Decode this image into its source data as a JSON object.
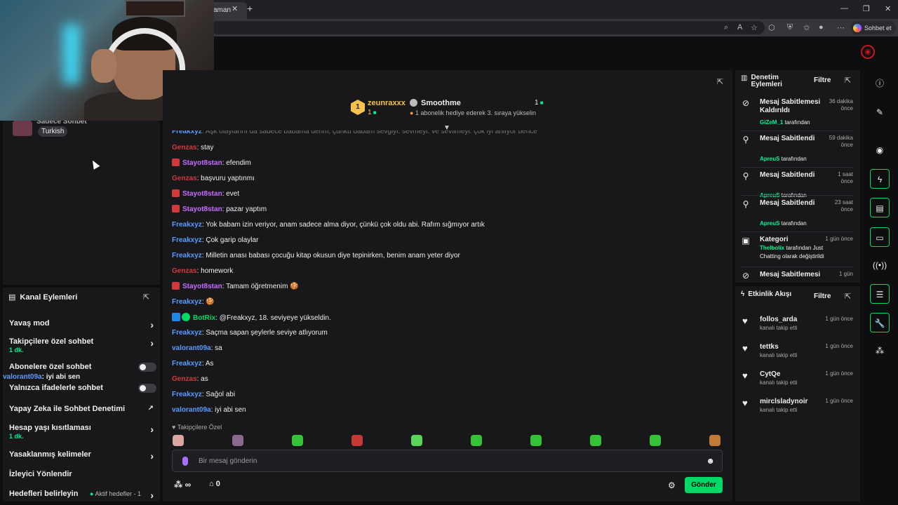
{
  "browser": {
    "tab_title": "aman",
    "copilot_label": "Sohbet et"
  },
  "stream_info": {
    "language_tag": "Turkish",
    "user_line": "Sadece Sohbet"
  },
  "hype_train": {
    "top_user": "zeunraxxx",
    "top_user_count": "1",
    "level_badge": "1",
    "second_user": "Smoothme",
    "second_count": "1",
    "sub_text": "1 abonelik hediye ederek 3. sıraya yükselin"
  },
  "channel_actions": {
    "title": "Kanal Eylemleri",
    "items": [
      {
        "label": "Yavaş mod",
        "sub": ""
      },
      {
        "label": "Takipçilere özel sohbet",
        "sub": "1 dk."
      },
      {
        "label": "Abonelere özel sohbet",
        "sub": ""
      },
      {
        "label": "Yalnızca ifadelerle sohbet",
        "sub": ""
      },
      {
        "label": "Yapay Zeka ile Sohbet Denetimi",
        "sub": ""
      },
      {
        "label": "Hesap yaşı kısıtlaması",
        "sub": "1 dk."
      },
      {
        "label": "Yasaklanmış kelimeler",
        "sub": ""
      },
      {
        "label": "İzleyici Yönlendir",
        "sub": ""
      },
      {
        "label": "Hedefleri belirleyin",
        "sub": ""
      }
    ],
    "goals_tag": "Aktif hedefler - 1",
    "overlay_user": "valorant09a",
    "overlay_text": ": iyi abi sen"
  },
  "chat": {
    "messages": [
      {
        "user": "Freakxyz",
        "color": "blue",
        "badge": "",
        "text": ": Aşk olaylarını da sadece babama derim, çünkü babam sevgiyi. sevmeyi. ve sevilmeyi. çok iyi anlıyor bence"
      },
      {
        "user": "Genzas",
        "color": "red",
        "badge": "",
        "text": ": stay"
      },
      {
        "user": "Stayot8stan",
        "color": "purple",
        "badge": "red",
        "text": ": efendim"
      },
      {
        "user": "Genzas",
        "color": "red",
        "badge": "",
        "text": ": başvuru yaptınmı"
      },
      {
        "user": "Stayot8stan",
        "color": "purple",
        "badge": "red",
        "text": ": evet"
      },
      {
        "user": "Stayot8stan",
        "color": "purple",
        "badge": "red",
        "text": ": pazar yaptım"
      },
      {
        "user": "Freakxyz",
        "color": "blue",
        "badge": "",
        "text": ": Yok babam izin veriyor, anam sadece alma diyor, çünkü çok oldu abi. Rafım sığmıyor artık"
      },
      {
        "user": "Freakxyz",
        "color": "blue",
        "badge": "",
        "text": ": Çok garip olaylar"
      },
      {
        "user": "Freakxyz",
        "color": "blue",
        "badge": "",
        "text": ": Milletin anası babası çocuğu kitap okusun diye tepinirken, benim anam yeter diyor"
      },
      {
        "user": "Genzas",
        "color": "red",
        "badge": "",
        "text": ": homework"
      },
      {
        "user": "Stayot8stan",
        "color": "purple",
        "badge": "red",
        "text": ": Tamam öğretmenim 🍪"
      },
      {
        "user": "Freakxyz",
        "color": "blue",
        "badge": "",
        "text": ": 🍪"
      },
      {
        "user": "BotRix",
        "color": "green",
        "badge": "bot",
        "text": ": @Freakxyz, 18. seviyeye yükseldin."
      },
      {
        "user": "Freakxyz",
        "color": "blue",
        "badge": "",
        "text": ": Saçma sapan şeylerle seviye atlıyorum"
      },
      {
        "user": "valorant09a",
        "color": "blue",
        "badge": "",
        "text": ": sa"
      },
      {
        "user": "Freakxyz",
        "color": "blue",
        "badge": "",
        "text": ": As"
      },
      {
        "user": "Genzas",
        "color": "red",
        "badge": "",
        "text": ": as"
      },
      {
        "user": "Freakxyz",
        "color": "blue",
        "badge": "",
        "text": ": Sağol abi"
      },
      {
        "user": "valorant09a",
        "color": "blue",
        "badge": "",
        "text": ": iyi abi sen"
      }
    ],
    "emote_label": "Takipçilere Özel",
    "emote_colors": [
      "#d9a6a0",
      "#8a6a8a",
      "#36c236",
      "#c23a36",
      "#5ad45a",
      "#36c236",
      "#36c236",
      "#36c236",
      "#36c236",
      "#c27a36"
    ],
    "input_placeholder": "Bir mesaj gönderin",
    "points": "0",
    "send_label": "Gönder"
  },
  "mod_log": {
    "title": "Denetim Eylemleri",
    "filter": "Filtre",
    "items": [
      {
        "icon": "unpin-icon",
        "title": "Mesaj Sabitlemesi Kaldırıldı",
        "time": "36 dakika önce",
        "by": "GiZeM_1",
        "suffix": " tarafından"
      },
      {
        "icon": "pin-icon",
        "title": "Mesaj Sabitlendi",
        "time": "59 dakika önce",
        "by": "ApreuS",
        "suffix": " tarafından"
      },
      {
        "icon": "pin-icon",
        "title": "Mesaj Sabitlendi",
        "time": "1 saat önce",
        "by": "ApreuS",
        "suffix": " tarafından"
      },
      {
        "icon": "pin-icon",
        "title": "Mesaj Sabitlendi",
        "time": "23 saat önce",
        "by": "ApreuS",
        "suffix": " tarafından"
      },
      {
        "icon": "category-icon",
        "title": "Kategori",
        "time": "1 gün önce",
        "by": "Thelbolix",
        "suffix": " tarafından Just Chatting olarak değiştirildi"
      },
      {
        "icon": "unpin-icon",
        "title": "Mesaj Sabitlemesi",
        "time": "1 gün",
        "by": "",
        "suffix": ""
      }
    ]
  },
  "activity": {
    "title": "Etkinlik Akışı",
    "filter": "Filtre",
    "items": [
      {
        "name": "follos_arda",
        "sub": "kanalı takip etti",
        "time": "1 gün önce"
      },
      {
        "name": "tettks",
        "sub": "kanalı takip etti",
        "time": "1 gün önce"
      },
      {
        "name": "CytQe",
        "sub": "kanalı takip etti",
        "time": "1 gün önce"
      },
      {
        "name": "mirclsladynoir",
        "sub": "kanalı takip etti",
        "time": "1 gün önce"
      }
    ]
  },
  "colors": {
    "accent_green": "#00d966",
    "brand_purple": "#a970ff",
    "background": "#0e0e10",
    "panel": "#18181b"
  }
}
